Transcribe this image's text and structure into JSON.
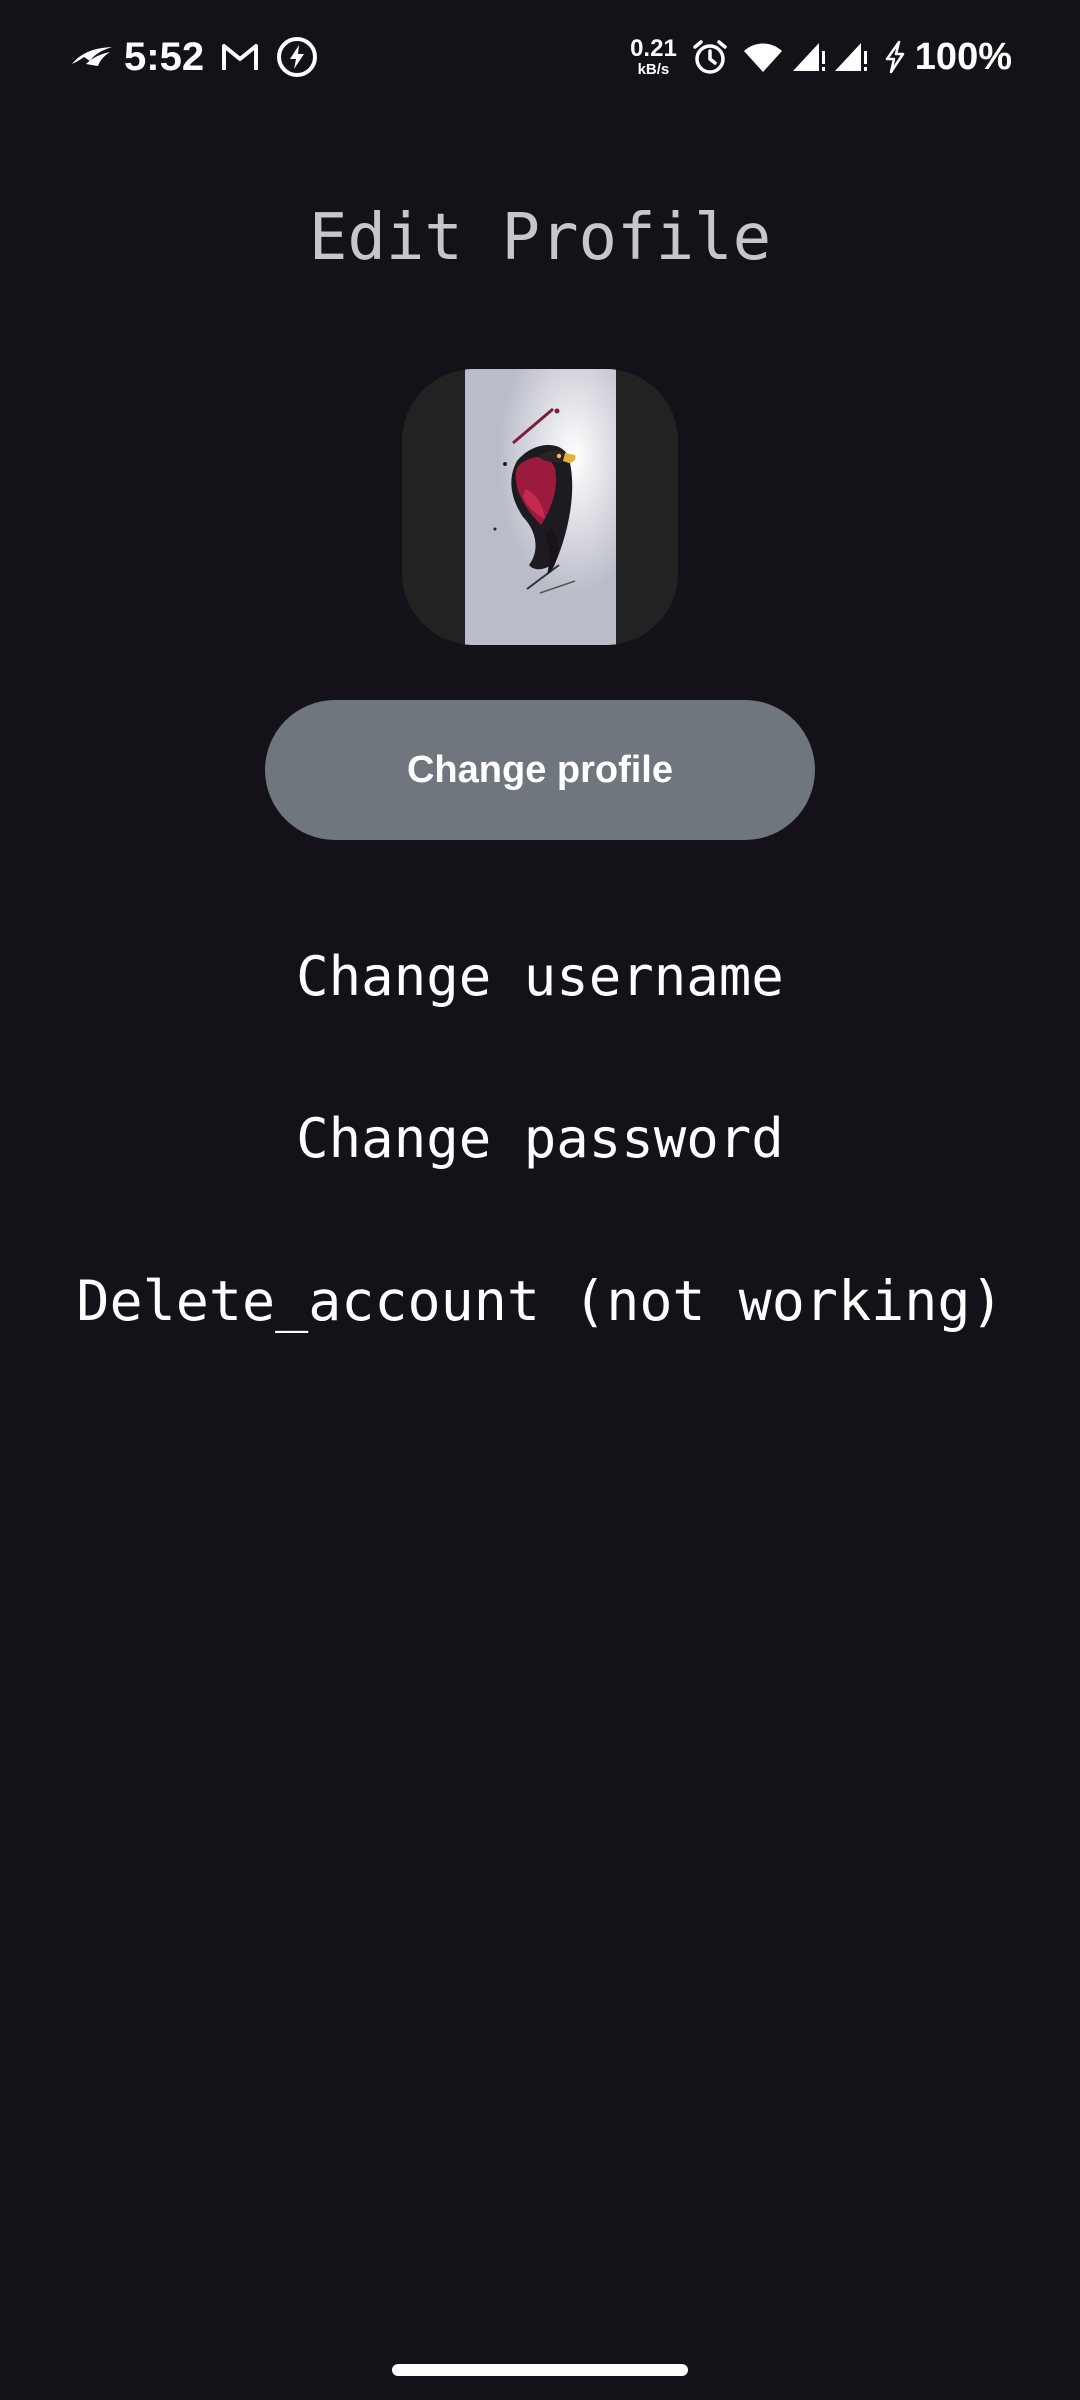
{
  "status_bar": {
    "time": "5:52",
    "network_speed_value": "0.21",
    "network_speed_unit": "kB/s",
    "battery": "100%",
    "icons": [
      "rog-logo-icon",
      "gmail-icon",
      "charging-bolt-icon",
      "alarm-icon",
      "wifi-icon",
      "signal-icon",
      "signal-icon",
      "charging-icon"
    ]
  },
  "page": {
    "title": "Edit Profile"
  },
  "profile": {
    "avatar": "eagle-illustration"
  },
  "actions": {
    "change_profile": "Change profile",
    "change_username": "Change username",
    "change_password": "Change password",
    "delete_account": "Delete_account (not working)"
  },
  "colors": {
    "background": "#141218",
    "button": "#6f767e",
    "title": "#c9c5cc",
    "avatar_frame": "#232223",
    "avatar_bg": "#babcc9"
  }
}
